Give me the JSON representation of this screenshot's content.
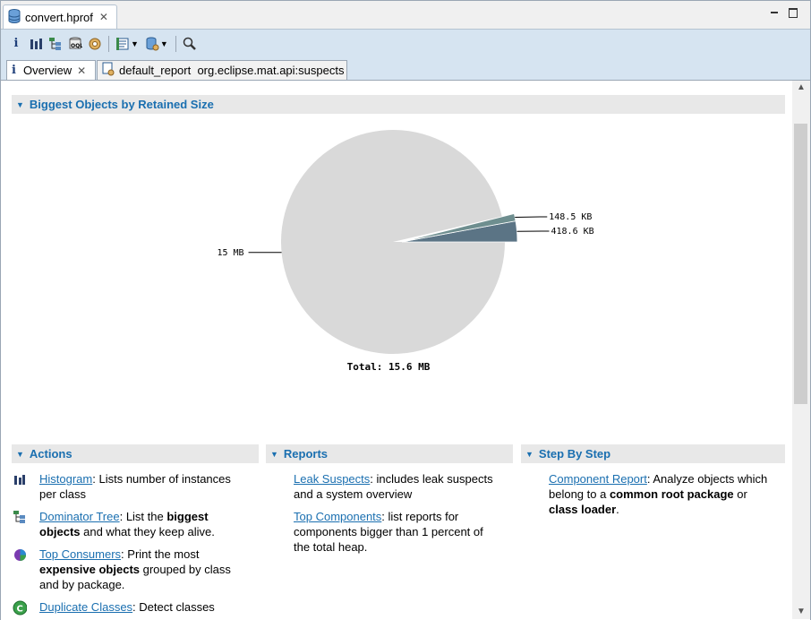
{
  "editor_tab": {
    "label": "convert.hprof",
    "close": "✕"
  },
  "window_buttons": {
    "minimize": "minimize",
    "maximize": "maximize"
  },
  "toolbar": {
    "items": [
      "info-icon",
      "histogram-icon",
      "dominator-tree-icon",
      "oql-icon",
      "heap-dump-overview-icon",
      "run-report-icon",
      "query-browser-icon",
      "find-object-icon"
    ]
  },
  "subtabs": [
    {
      "label": "Overview",
      "close": "✕"
    },
    {
      "label": "default_report  org.eclipse.mat.api:suspects"
    }
  ],
  "sections": {
    "biggest": "Biggest Objects by Retained Size",
    "actions": "Actions",
    "reports": "Reports",
    "step": "Step By Step"
  },
  "chart_data": {
    "type": "pie",
    "title": "Total: 15.6 MB",
    "slices": [
      {
        "label": "15 MB",
        "value": 15000,
        "color": "#d9d9d9"
      },
      {
        "label": "148.5 KB",
        "value": 148.5,
        "color": "#6e8e8f"
      },
      {
        "label": "418.6 KB",
        "value": 418.6,
        "color": "#5b7485"
      }
    ]
  },
  "actions": [
    {
      "link": "Histogram",
      "rest1": ": Lists number of instances per class",
      "bold": "",
      "rest2": ""
    },
    {
      "link": "Dominator Tree",
      "rest1": ": List the ",
      "bold": "biggest objects",
      "rest2": " and what they keep alive."
    },
    {
      "link": "Top Consumers",
      "rest1": ": Print the most ",
      "bold": "expensive objects",
      "rest2": " grouped by class and by package."
    },
    {
      "link": "Duplicate Classes",
      "rest1": ": Detect classes",
      "bold": "",
      "rest2": ""
    }
  ],
  "reports": [
    {
      "link": "Leak Suspects",
      "rest1": ": includes leak suspects and a system overview"
    },
    {
      "link": "Top Components",
      "rest1": ": list reports for components bigger than 1 percent of the total heap."
    }
  ],
  "steps": [
    {
      "link": "Component Report",
      "rest1": ": Analyze objects which belong to a ",
      "bold1": "common root package",
      "mid": " or ",
      "bold2": "class loader",
      "end": "."
    }
  ]
}
